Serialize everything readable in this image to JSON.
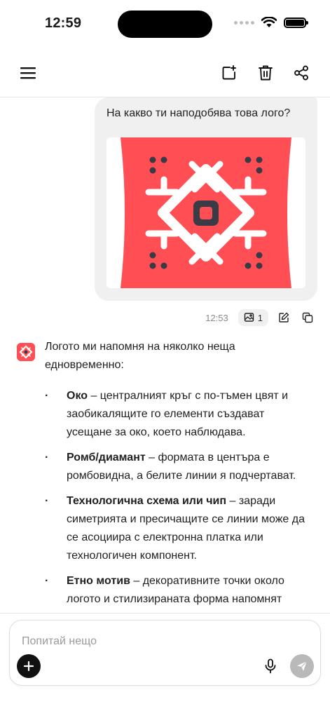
{
  "status": {
    "time": "12:59"
  },
  "icons": {
    "menu": "hamburger-icon",
    "new_chat": "new-chat-icon",
    "delete": "trash-icon",
    "share": "share-icon",
    "image": "image-icon",
    "edit": "edit-icon",
    "copy": "copy-icon",
    "mic": "microphone-icon",
    "send": "send-icon",
    "plus": "plus-icon"
  },
  "colors": {
    "logo_red": "#FF4F55",
    "logo_dark": "#3B3B45",
    "send_disabled": "#B9B9B9"
  },
  "user_message": {
    "text": "На какво ти наподобява това лого?",
    "time": "12:53",
    "image_count": "1"
  },
  "assistant_message": {
    "intro": "Логото ми напомня на няколко неща едновременно:",
    "bullets": [
      {
        "title": "Око",
        "text": " – централният кръг с по-тъмен цвят и заобикалящите го елементи създават усещане за око, което наблюдава."
      },
      {
        "title": "Ромб/диамант",
        "text": " – формата в центъра е ромбовидна, а белите линии я подчертават."
      },
      {
        "title": "Технологична схема или чип",
        "text": " – заради симетрията и пресичащите се линии може да се асоциира с електронна платка или технологичен компонент."
      },
      {
        "title": "Етно мотив",
        "text": " – декоративните точки около логото и стилизираната форма напомнят"
      }
    ]
  },
  "composer": {
    "placeholder": "Попитай нещо"
  }
}
